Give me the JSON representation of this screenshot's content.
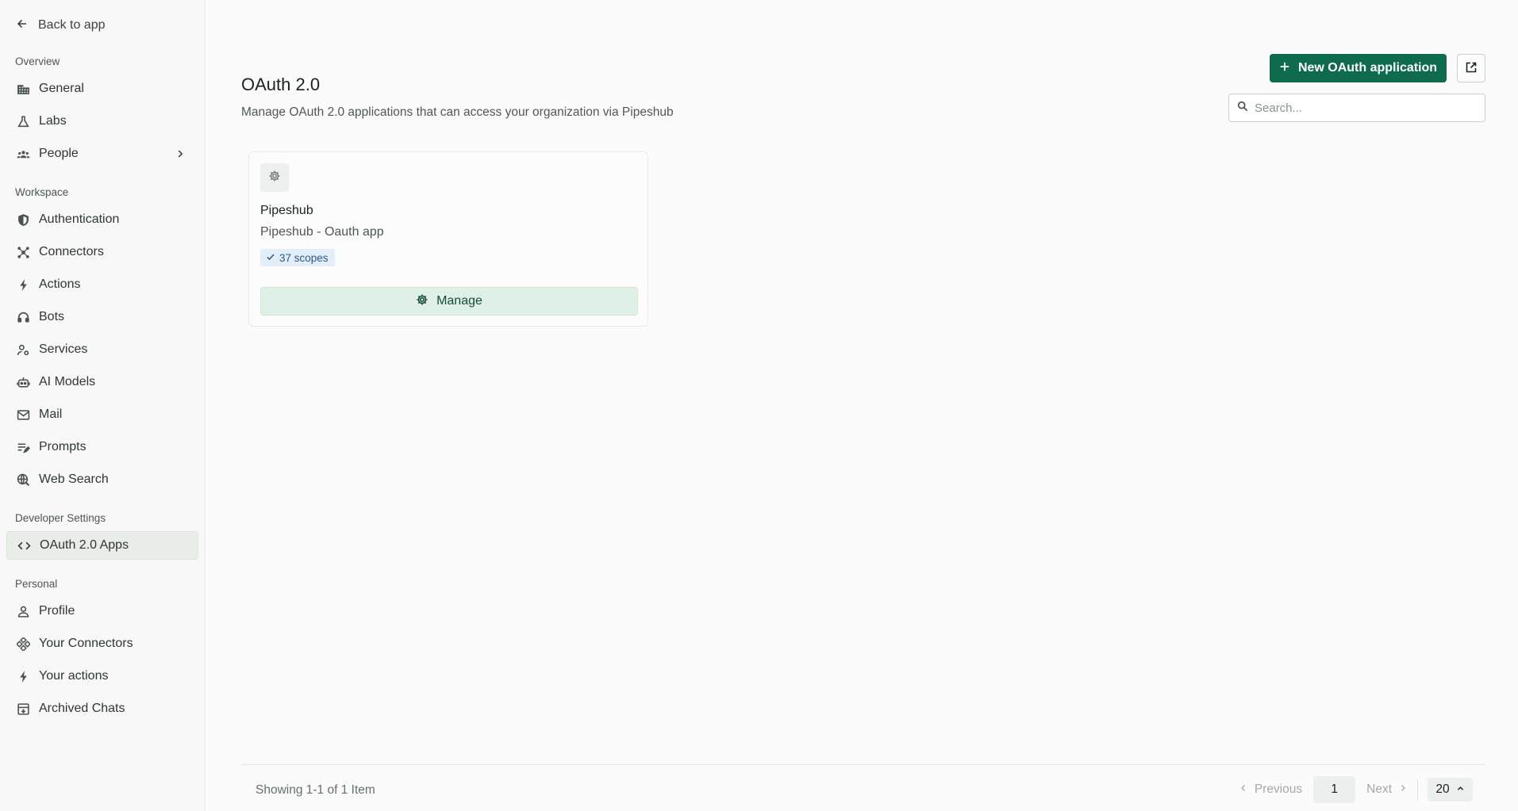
{
  "sidebar": {
    "back_label": "Back to app",
    "sections": {
      "overview": "Overview",
      "workspace": "Workspace",
      "developer": "Developer Settings",
      "personal": "Personal"
    },
    "overview_items": [
      "General",
      "Labs",
      "People"
    ],
    "workspace_items": [
      "Authentication",
      "Connectors",
      "Actions",
      "Bots",
      "Services",
      "AI Models",
      "Mail",
      "Prompts",
      "Web Search"
    ],
    "developer_items": [
      "OAuth 2.0 Apps"
    ],
    "personal_items": [
      "Profile",
      "Your Connectors",
      "Your actions",
      "Archived Chats"
    ],
    "active_item": "OAuth 2.0 Apps"
  },
  "header": {
    "title": "OAuth 2.0",
    "subtitle": "Manage OAuth 2.0 applications that can access your organization via Pipeshub",
    "new_button_label": "New OAuth application",
    "search_placeholder": "Search..."
  },
  "apps": [
    {
      "name": "Pipeshub",
      "description": "Pipeshub - Oauth app",
      "scopes_label": "37 scopes",
      "manage_label": "Manage"
    }
  ],
  "pagination": {
    "showing_text": "Showing 1-1 of 1 Item",
    "previous_label": "Previous",
    "current_page": "1",
    "next_label": "Next",
    "page_size": "20"
  },
  "colors": {
    "primary": "#0e6b4d",
    "manage_bg": "#dff0e6",
    "scopes_bg": "#e3eef8"
  }
}
